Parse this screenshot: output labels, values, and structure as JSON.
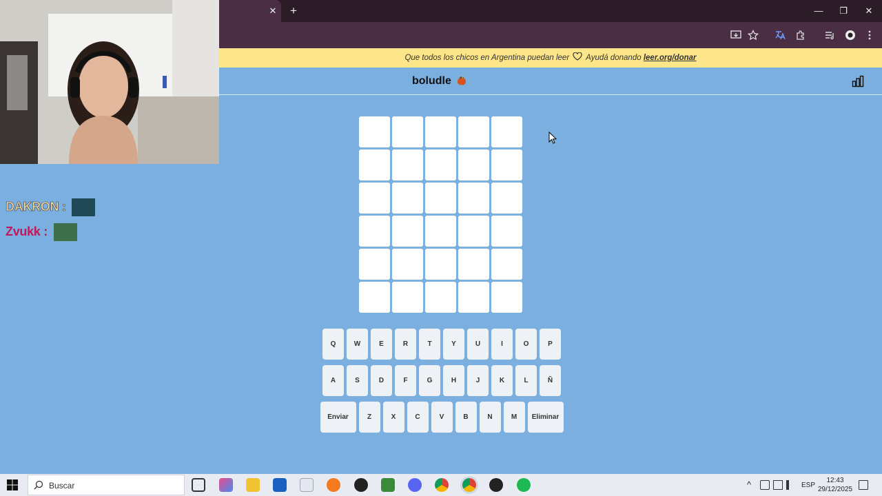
{
  "banner": {
    "text_before": "Que todos los chicos en Argentina puedan leer",
    "text_after": "Ayudá donando",
    "link": "leer.org/donar"
  },
  "game": {
    "title": "boludle",
    "rows": 6,
    "cols": 5
  },
  "keyboard": {
    "row1": [
      "Q",
      "W",
      "E",
      "R",
      "T",
      "Y",
      "U",
      "I",
      "O",
      "P"
    ],
    "row2": [
      "A",
      "S",
      "D",
      "F",
      "G",
      "H",
      "J",
      "K",
      "L",
      "Ñ"
    ],
    "row3": [
      "Enviar",
      "Z",
      "X",
      "C",
      "V",
      "B",
      "N",
      "M",
      "Eliminar"
    ]
  },
  "chat": [
    {
      "name": "DAKRON :",
      "color": "#f3d9a4"
    },
    {
      "name": "Zvukk :",
      "color": "#c2185b"
    }
  ],
  "taskbar": {
    "search_placeholder": "Buscar",
    "language": "ESP",
    "time": "12:43",
    "date": "29/12/2025"
  },
  "colors": {
    "page_bg": "#7aafdf",
    "banner_bg": "#fde68a",
    "tile": "#ffffff",
    "key": "#eef2f6"
  }
}
